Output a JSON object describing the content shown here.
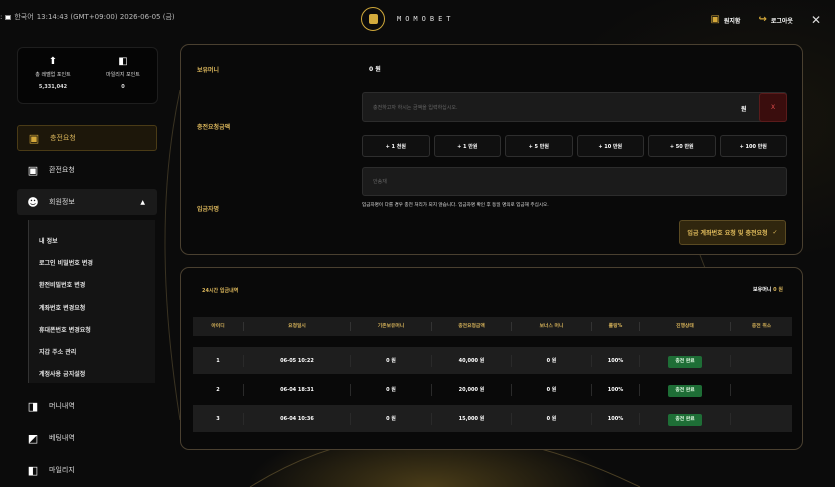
{
  "topbar": {
    "locale_label": "한국어",
    "datetime": "13:14:43 (GMT+09:00) 2026-06-05 (금)",
    "brand": "MOMOBET",
    "wallet_label": "원지함",
    "logout_label": "로그아웃"
  },
  "points": {
    "rolling_label": "총 레벨업 포인트",
    "rolling_value": "5,331,042",
    "mileage_label": "마일리지 포인트",
    "mileage_value": "0"
  },
  "sidebar": {
    "deposit": "충전요청",
    "withdraw": "환전요청",
    "member_info": "회원정보",
    "submenu": [
      "내 정보",
      "로그인 비밀번호 변경",
      "환전비밀번호 변경",
      "계좌번호 변경요청",
      "휴대폰번호 변경요청",
      "지갑 주소 관리",
      "계정사용 금지설정"
    ],
    "money_history": "머니내역",
    "betting_history": "베팅내역",
    "mileage": "마일리지"
  },
  "deposit_form": {
    "balance_label": "보유머니",
    "balance_value": "0 원",
    "amount_label": "충전요청금액",
    "amount_placeholder": "충전하고자 하시는 금액을 입력하십시오.",
    "won_unit": "원",
    "clear_label": "X",
    "quick_amounts": [
      "+ 1 천원",
      "+ 1 만원",
      "+ 5 만원",
      "+ 10 만원",
      "+ 50 만원",
      "+ 100 만원"
    ],
    "depositor_label": "입금자명",
    "depositor_placeholder": "안송재",
    "notice": "입금자명이 다를 경우 충전 처리가 되지 않습니다. 입금자명 확인 후 동일 명의로 입금해 주십시오.",
    "submit_label": "입금 계좌번호 요청 및 충전요청",
    "submit_icon": "check-icon"
  },
  "history": {
    "title": "24시간 입금내역",
    "balance_label": "보유머니",
    "balance_value": "0 원",
    "columns": [
      "아이디",
      "요청일시",
      "기존보유머니",
      "충전요청금액",
      "보너스 머니",
      "롤링%",
      "진행상태",
      "충전 취소"
    ],
    "rows": [
      {
        "id": "1",
        "date": "06-05 10:22",
        "prev": "0 원",
        "amount": "40,000 원",
        "bonus": "0 원",
        "rolling": "100%",
        "status": "충전 완료",
        "cancel": ""
      },
      {
        "id": "2",
        "date": "06-04 18:31",
        "prev": "0 원",
        "amount": "20,000 원",
        "bonus": "0 원",
        "rolling": "100%",
        "status": "충전 완료",
        "cancel": ""
      },
      {
        "id": "3",
        "date": "06-04 10:36",
        "prev": "0 원",
        "amount": "15,000 원",
        "bonus": "0 원",
        "rolling": "100%",
        "status": "충전 완료",
        "cancel": ""
      }
    ]
  },
  "colors": {
    "accent_gold": "#d8b45a",
    "status_green": "#1e6e36",
    "clear_red": "#e34d4d"
  }
}
